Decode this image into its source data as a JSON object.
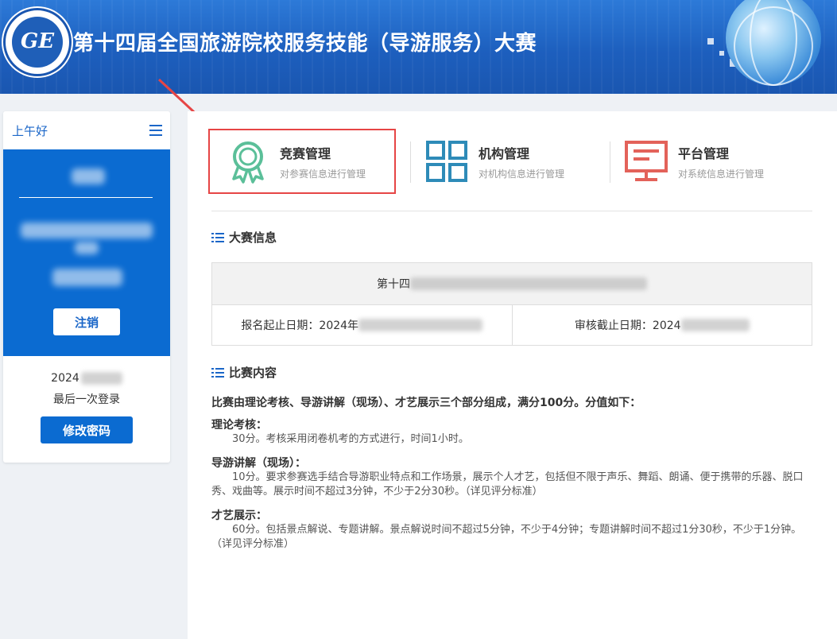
{
  "header": {
    "logo_text": "GE",
    "logo_ring_text": "中国旅游教育 China Tourism Education",
    "title": "第十四届全国旅游院校服务技能（导游服务）大赛"
  },
  "sidebar": {
    "greeting": "上午好",
    "menu_icon": "hamburger-menu-icon",
    "logout_label": "注销",
    "last_login_date": "2024",
    "last_login_label": "最后一次登录",
    "change_password_label": "修改密码"
  },
  "cards": [
    {
      "title": "竞赛管理",
      "subtitle": "对参赛信息进行管理",
      "icon": "award-icon",
      "color": "#5bbf99",
      "active": true
    },
    {
      "title": "机构管理",
      "subtitle": "对机构信息进行管理",
      "icon": "grid-icon",
      "color": "#2e8bb8",
      "active": false
    },
    {
      "title": "平台管理",
      "subtitle": "对系统信息进行管理",
      "icon": "monitor-icon",
      "color": "#e3625a",
      "active": false
    }
  ],
  "contest_info": {
    "heading": "大赛信息",
    "name": "第十四",
    "signup_label": "报名起止日期：2024年",
    "review_label": "审核截止日期：2024"
  },
  "contest_content": {
    "heading": "比赛内容",
    "intro": "比赛由理论考核、导游讲解（现场）、才艺展示三个部分组成，满分100分。分值如下：",
    "sections": [
      {
        "title": "理论考核：",
        "text": "30分。考核采用闭卷机考的方式进行，时间1小时。"
      },
      {
        "title": "导游讲解（现场）：",
        "text": "10分。要求参赛选手结合导游职业特点和工作场景，展示个人才艺，包括但不限于声乐、舞蹈、朗诵、便于携带的乐器、脱口秀、戏曲等。展示时间不超过3分钟，不少于2分30秒。（详见评分标准）"
      },
      {
        "title": "才艺展示：",
        "text": "60分。包括景点解说、专题讲解。景点解说时间不超过5分钟，不少于4分钟；专题讲解时间不超过1分30秒，不少于1分钟。（详见评分标准）"
      }
    ]
  },
  "colors": {
    "header_blue": "#1d5fbe",
    "primary": "#0b6bd1",
    "highlight_red": "#e64545"
  }
}
